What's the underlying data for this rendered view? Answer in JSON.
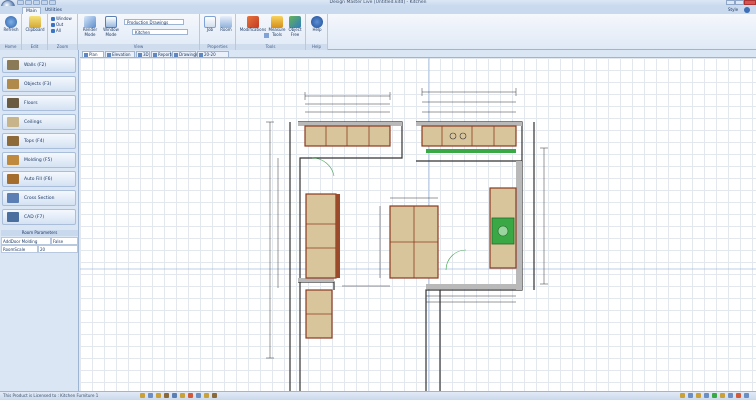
{
  "window": {
    "title": "Design Master Live [Untitled.kitd] - Kitchen",
    "style_label": "Style"
  },
  "tabs": [
    {
      "label": "Main",
      "active": true
    },
    {
      "label": "Utilities",
      "active": false
    }
  ],
  "ribbon": {
    "home": {
      "refresh_label": "Refresh",
      "group_label": "Home"
    },
    "edit": {
      "clipboard_label": "Clipboard",
      "group_label": "Edit"
    },
    "zoom": {
      "window_label": "Window",
      "out_label": "Out",
      "all_label": "All",
      "group_label": "Zoom"
    },
    "view": {
      "render_mode_label": "Render Mode",
      "window_mode_label": "Window Mode",
      "production_drawings_label": "Production Drawings",
      "room_value": "Kitchen",
      "group_label": "View"
    },
    "properties": {
      "job_label": "Job",
      "room_label": "Room",
      "group_label": "Properties"
    },
    "tools": {
      "modifications_label": "Modifications",
      "measure_tools_label": "Measure Tools",
      "object_free_label": "Object Free",
      "group_label": "Tools"
    },
    "help": {
      "help_label": "Help",
      "group_label": "Help"
    }
  },
  "left_panel": {
    "buttons": [
      {
        "label": "Walls (F2)",
        "icon": "walls-icon",
        "color": "#8a7a55"
      },
      {
        "label": "Objects (F3)",
        "icon": "objects-icon",
        "color": "#b08a4a"
      },
      {
        "label": "Floors",
        "icon": "floors-icon",
        "color": "#6a5a40"
      },
      {
        "label": "Ceilings",
        "icon": "ceilings-icon",
        "color": "#c7b48a"
      },
      {
        "label": "Tops (F4)",
        "icon": "tops-icon",
        "color": "#8e6a3a"
      },
      {
        "label": "Molding (F5)",
        "icon": "molding-icon",
        "color": "#c08a3e"
      },
      {
        "label": "Auto Fill (F6)",
        "icon": "auto-fill-icon",
        "color": "#a46d2d"
      },
      {
        "label": "Cross Section",
        "icon": "cross-section-icon",
        "color": "#5b7fb5"
      },
      {
        "label": "CAD (F7)",
        "icon": "cad-icon",
        "color": "#4a6f9e"
      }
    ],
    "room_parameters": {
      "title": "Room Parameters",
      "rows": [
        {
          "name": "AddDoor Molding",
          "value": "False"
        },
        {
          "name": "RoomScale",
          "value": "20"
        }
      ]
    }
  },
  "doc_tabs": [
    "Plan",
    "Elevation",
    "3D",
    "Reports",
    "Drawings",
    "20-20 Center"
  ],
  "status": {
    "text": "This Product is Licensed to : Kitchen Furniture 1"
  },
  "colors": {
    "accent": "#15325f",
    "cabinet_fill": "#d9c59b",
    "cabinet_edge": "#8b3a1e",
    "cabinet_glass": "#3aa845",
    "wall": "#333333",
    "guide": "#7fa3d6"
  }
}
